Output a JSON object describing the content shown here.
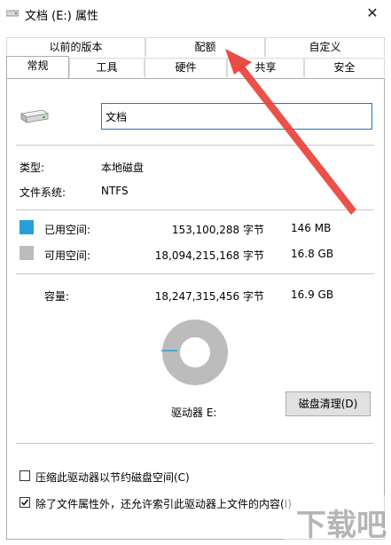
{
  "window": {
    "title": "文档 (E:) 属性",
    "close_glyph": "✕"
  },
  "tabs": {
    "row1": [
      "以前的版本",
      "配额",
      "自定义"
    ],
    "row2": [
      "常规",
      "工具",
      "硬件",
      "共享",
      "安全"
    ],
    "active": "常规"
  },
  "general": {
    "name_value": "文档",
    "type_label": "类型:",
    "type_value": "本地磁盘",
    "fs_label": "文件系统:",
    "fs_value": "NTFS",
    "used": {
      "label": "已用空间:",
      "bytes": "153,100,288 字节",
      "size": "146 MB",
      "color": "#26a0da"
    },
    "free": {
      "label": "可用空间:",
      "bytes": "18,094,215,168 字节",
      "size": "16.8 GB",
      "color": "#bcbcbc"
    },
    "capacity": {
      "label": "容量:",
      "bytes": "18,247,315,456 字节",
      "size": "16.9 GB"
    },
    "drive_label": "驱动器 E:",
    "cleanup_button": "磁盘清理(D)",
    "compress_checkbox": {
      "label": "压缩此驱动器以节约磁盘空间(C)",
      "checked": false
    },
    "index_checkbox": {
      "label": "除了文件属性外，还允许索引此驱动器上文件的内容(I)",
      "checked": true
    },
    "used_fraction": 0.0084
  },
  "annotation": {
    "arrow_color": "#e8423a"
  },
  "watermark": {
    "text": "下载吧"
  }
}
